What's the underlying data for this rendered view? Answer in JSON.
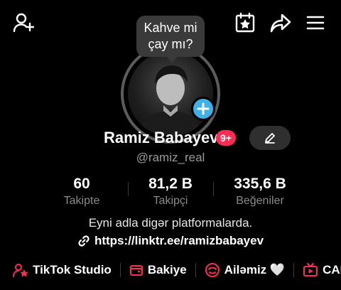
{
  "colors": {
    "accent": "#fe2c55",
    "badge_blue": "#3fb0e8",
    "background": "#000000"
  },
  "header": {
    "icons": [
      "add-friend-icon",
      "calendar-star-icon",
      "share-icon",
      "menu-icon"
    ]
  },
  "profile": {
    "bubble_line1": "Kahve mi",
    "bubble_line2": "çay mı?",
    "name": "Ramiz Babayev",
    "notification_badge": "9+",
    "username": "@ramiz_real"
  },
  "stats": [
    {
      "value": "60",
      "label": "Takipte"
    },
    {
      "value": "81,2 B",
      "label": "Takipçi"
    },
    {
      "value": "335,6 B",
      "label": "Beğeniler"
    }
  ],
  "bio": {
    "text": "Eyni adla digər platformalarda.",
    "link": "https://linktr.ee/ramizbabayev"
  },
  "shortcuts": [
    {
      "label": "TikTok Studio",
      "icon": "studio-icon"
    },
    {
      "label": "Bakiye",
      "icon": "wallet-icon"
    },
    {
      "label": "Ailəmiz 🤍",
      "icon": "family-icon"
    },
    {
      "label": "CANL",
      "icon": "live-tv-icon"
    }
  ]
}
